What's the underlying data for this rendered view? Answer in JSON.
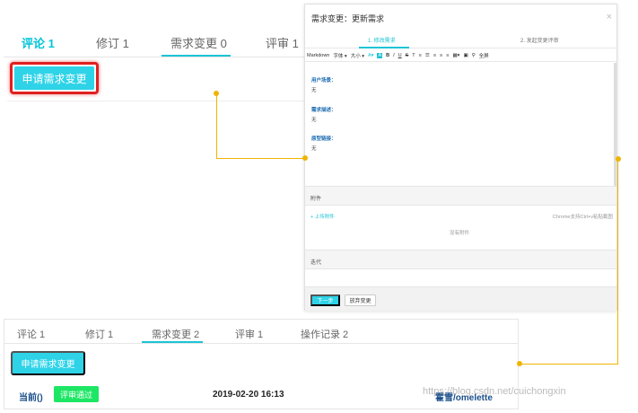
{
  "top_panel": {
    "tabs": [
      {
        "label": "评论 1"
      },
      {
        "label": "修订 1"
      },
      {
        "label": "需求变更 0"
      },
      {
        "label": "评审 1"
      }
    ],
    "apply_button": "申请需求变更"
  },
  "modal": {
    "title": "需求变更：更新需求",
    "close": "×",
    "steps": [
      {
        "label": "1. 修改需求"
      },
      {
        "label": "2. 发起变更评审"
      }
    ],
    "toolbar": {
      "mode": "Markdown",
      "font": "字体",
      "size": "大小",
      "fullscreen": "全屏"
    },
    "fields": [
      {
        "label": "用户场景：",
        "value": "无"
      },
      {
        "label": "需求描述：",
        "value": "无"
      },
      {
        "label": "原型链接：",
        "value": "无"
      }
    ],
    "attachments": {
      "header": "附件",
      "upload": "+ 上传附件",
      "paste_hint": "Chrome支持Ctrl+v粘贴截图",
      "empty": "没有附件"
    },
    "iteration": {
      "header": "迭代"
    },
    "buttons": {
      "next": "下一步",
      "discard": "放弃变更"
    }
  },
  "bottom_panel": {
    "tabs": [
      {
        "label": "评论 1"
      },
      {
        "label": "修订 1"
      },
      {
        "label": "需求变更 2"
      },
      {
        "label": "评审 1"
      },
      {
        "label": "操作记录 2"
      }
    ],
    "apply_button": "申请需求变更",
    "row": {
      "current": "当前()",
      "status": "评审通过",
      "datetime": "2019-02-20 16:13",
      "user": "霍雪/omelette"
    },
    "watermark": "https://blog.csdn.net/cuichongxin"
  },
  "colors": {
    "accent": "#1cc4d6",
    "button": "#2ed3e8",
    "highlight_border": "#e02020",
    "connector": "#f0b400",
    "pass": "#1de664"
  }
}
